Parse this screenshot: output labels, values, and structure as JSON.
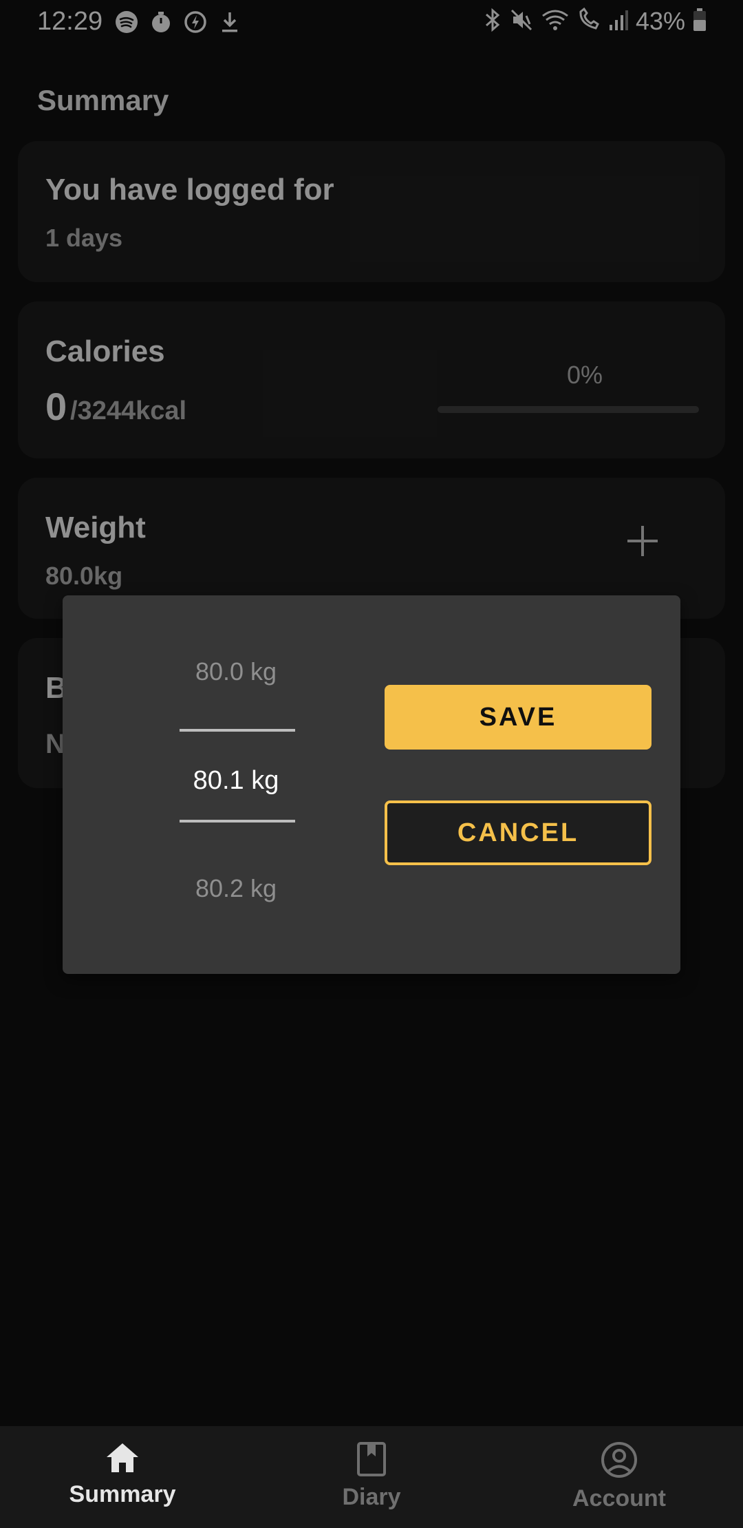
{
  "status_bar": {
    "time": "12:29",
    "battery": "43%",
    "left_icons": [
      "spotify-icon",
      "timer-icon",
      "power-save-icon",
      "download-icon"
    ],
    "right_icons": [
      "bluetooth-icon",
      "vibrate-mute-icon",
      "wifi-icon",
      "wifi-calling-icon",
      "signal-icon",
      "battery-icon"
    ]
  },
  "section_title": "Summary",
  "cards": {
    "logged": {
      "title": "You have logged for",
      "value": "1 days"
    },
    "calories": {
      "title": "Calories",
      "consumed": "0",
      "goal": "/3244kcal",
      "percent_text": "0%",
      "progress": 0
    },
    "weight": {
      "title": "Weight",
      "value": "80.0kg"
    },
    "hidden": {
      "title_initial": "B",
      "value_initial": "N"
    }
  },
  "dialog": {
    "options": [
      "80.0 kg",
      "80.1 kg",
      "80.2 kg"
    ],
    "selected": "80.1 kg",
    "save_label": "SAVE",
    "cancel_label": "CANCEL"
  },
  "bottom_nav": [
    {
      "label": "Summary",
      "icon": "home-icon",
      "active": true
    },
    {
      "label": "Diary",
      "icon": "book-icon",
      "active": false
    },
    {
      "label": "Account",
      "icon": "account-icon",
      "active": false
    }
  ],
  "colors": {
    "accent": "#f5c04a",
    "background": "#0f0f0f",
    "card": "#1b1b1b",
    "dialog": "#373737"
  }
}
